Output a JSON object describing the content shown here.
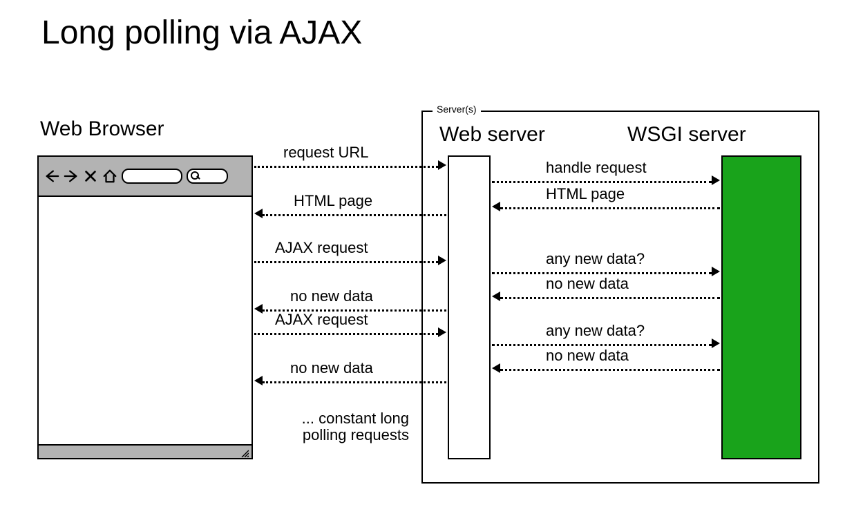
{
  "title": "Long polling via AJAX",
  "browser_label": "Web Browser",
  "servers_group_label": "Server(s)",
  "webserver_label": "Web server",
  "wsgi_label": "WSGI server",
  "left_messages": {
    "m1": "request URL",
    "m2": "HTML page",
    "m3": "AJAX request",
    "m4": "no new data",
    "m5": "AJAX request",
    "m6": "no new data"
  },
  "right_messages": {
    "r1": "handle request",
    "r2": "HTML page",
    "r3": "any new data?",
    "r4": "no new data",
    "r5": "any new data?",
    "r6": "no new data"
  },
  "footnote_line1": "... constant long",
  "footnote_line2": "polling requests",
  "colors": {
    "wsgi_fill": "#19a31b",
    "toolbar_fill": "#b3b3b3"
  },
  "chart_data": {
    "type": "sequence-diagram",
    "title": "Long polling via AJAX",
    "participants": [
      "Web Browser",
      "Web server",
      "WSGI server"
    ],
    "groups": [
      {
        "name": "Server(s)",
        "members": [
          "Web server",
          "WSGI server"
        ]
      }
    ],
    "messages": [
      {
        "from": "Web Browser",
        "to": "Web server",
        "label": "request URL"
      },
      {
        "from": "Web server",
        "to": "WSGI server",
        "label": "handle request"
      },
      {
        "from": "WSGI server",
        "to": "Web server",
        "label": "HTML page"
      },
      {
        "from": "Web server",
        "to": "Web Browser",
        "label": "HTML page"
      },
      {
        "from": "Web Browser",
        "to": "Web server",
        "label": "AJAX request"
      },
      {
        "from": "Web server",
        "to": "WSGI server",
        "label": "any new data?"
      },
      {
        "from": "WSGI server",
        "to": "Web server",
        "label": "no new data"
      },
      {
        "from": "Web server",
        "to": "Web Browser",
        "label": "no new data"
      },
      {
        "from": "Web Browser",
        "to": "Web server",
        "label": "AJAX request"
      },
      {
        "from": "Web server",
        "to": "WSGI server",
        "label": "any new data?"
      },
      {
        "from": "WSGI server",
        "to": "Web server",
        "label": "no new data"
      },
      {
        "from": "Web server",
        "to": "Web Browser",
        "label": "no new data"
      }
    ],
    "note": "... constant long polling requests"
  }
}
